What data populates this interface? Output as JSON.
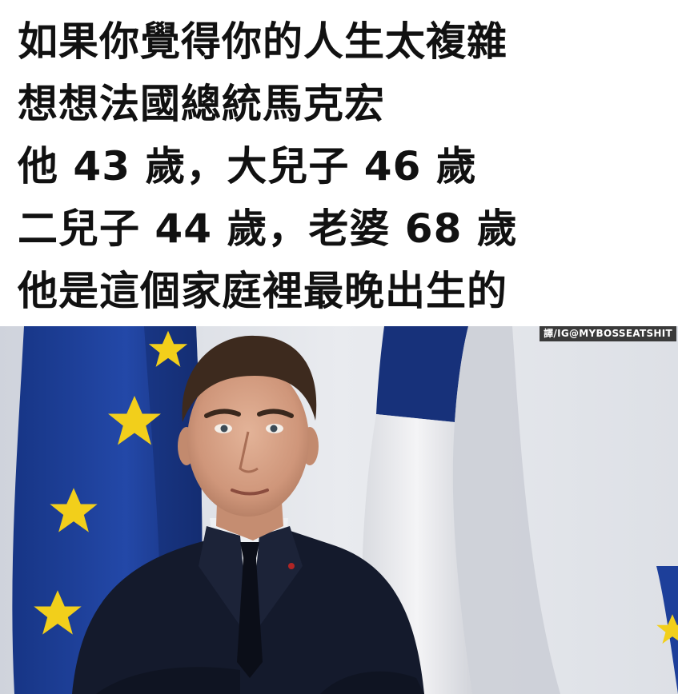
{
  "caption": {
    "lines": [
      "如果你覺得你的人生太複雜",
      "想想法國總統馬克宏",
      "他 43 歲，大兒子 46 歲",
      "二兒子 44 歲，老婆 68 歲",
      "他是這個家庭裡最晚出生的"
    ]
  },
  "credit": {
    "text": "譯/IG@MYBOSSEATSHIT"
  },
  "colors": {
    "text": "#111111",
    "background": "#ffffff",
    "eu_blue": "#1d3f9a",
    "eu_star": "#f2cf1b",
    "french_blue": "#17317a",
    "suit": "#141a2c"
  }
}
